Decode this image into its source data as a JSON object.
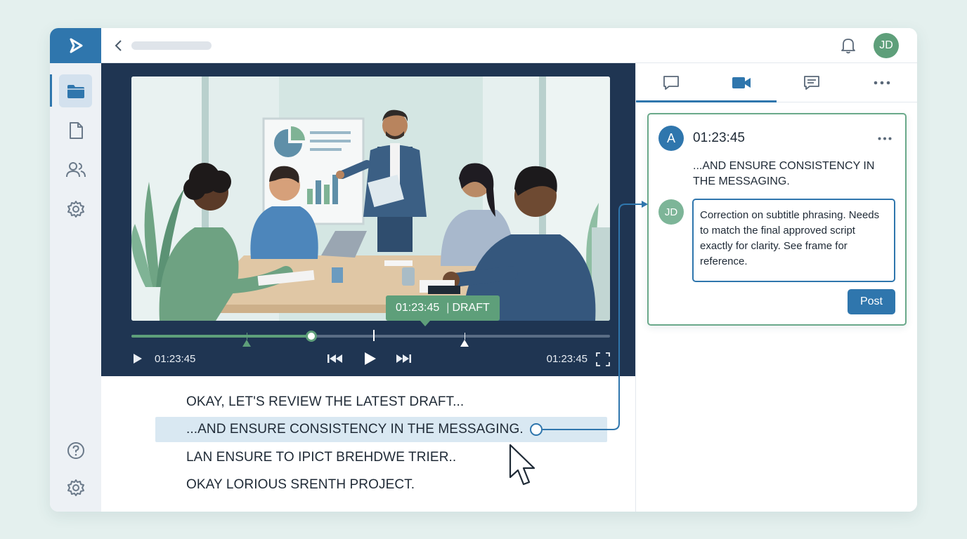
{
  "topbar": {
    "user_initials": "JD"
  },
  "player": {
    "badge_time": "01:23:45",
    "badge_sep": "|",
    "badge_status": "DRAFT",
    "current_time": "01:23:45",
    "total_time": "01:23:45",
    "progress_fraction": 0.376
  },
  "transcript": {
    "lines": [
      "OKAY, LET'S REVIEW THE LATEST DRAFT...",
      "...AND ENSURE CONSISTENCY IN THE MESSAGING.",
      "LAN ENSURE TO IPICT BREHDWE TRIER..",
      "OKAY LORIOUS SRENTH PROJECT."
    ]
  },
  "comment": {
    "author_initial": "A",
    "timestamp": "01:23:45",
    "quote": "...AND ENSURE CONSISTENCY IN THE MESSAGING.",
    "reply_initials": "JD",
    "reply_text": "Correction on subtitle phrasing. Needs to match the final approved script exactly for clarity. See frame for reference.",
    "post_label": "Post"
  },
  "colors": {
    "brand": "#2f76ad",
    "accent_green": "#5e9f7a",
    "player_bg": "#1f3552",
    "highlight": "#d9e8f2"
  },
  "icons": [
    "logo-play-icon",
    "folder-icon",
    "document-icon",
    "users-icon",
    "settings-icon",
    "help-icon",
    "chevron-left-icon",
    "bell-icon",
    "chat-bubble-icon",
    "video-camera-icon",
    "message-lines-icon",
    "more-horizontal-icon",
    "play-icon",
    "skip-back-icon",
    "skip-forward-icon",
    "fullscreen-icon",
    "mouse-pointer-icon"
  ]
}
